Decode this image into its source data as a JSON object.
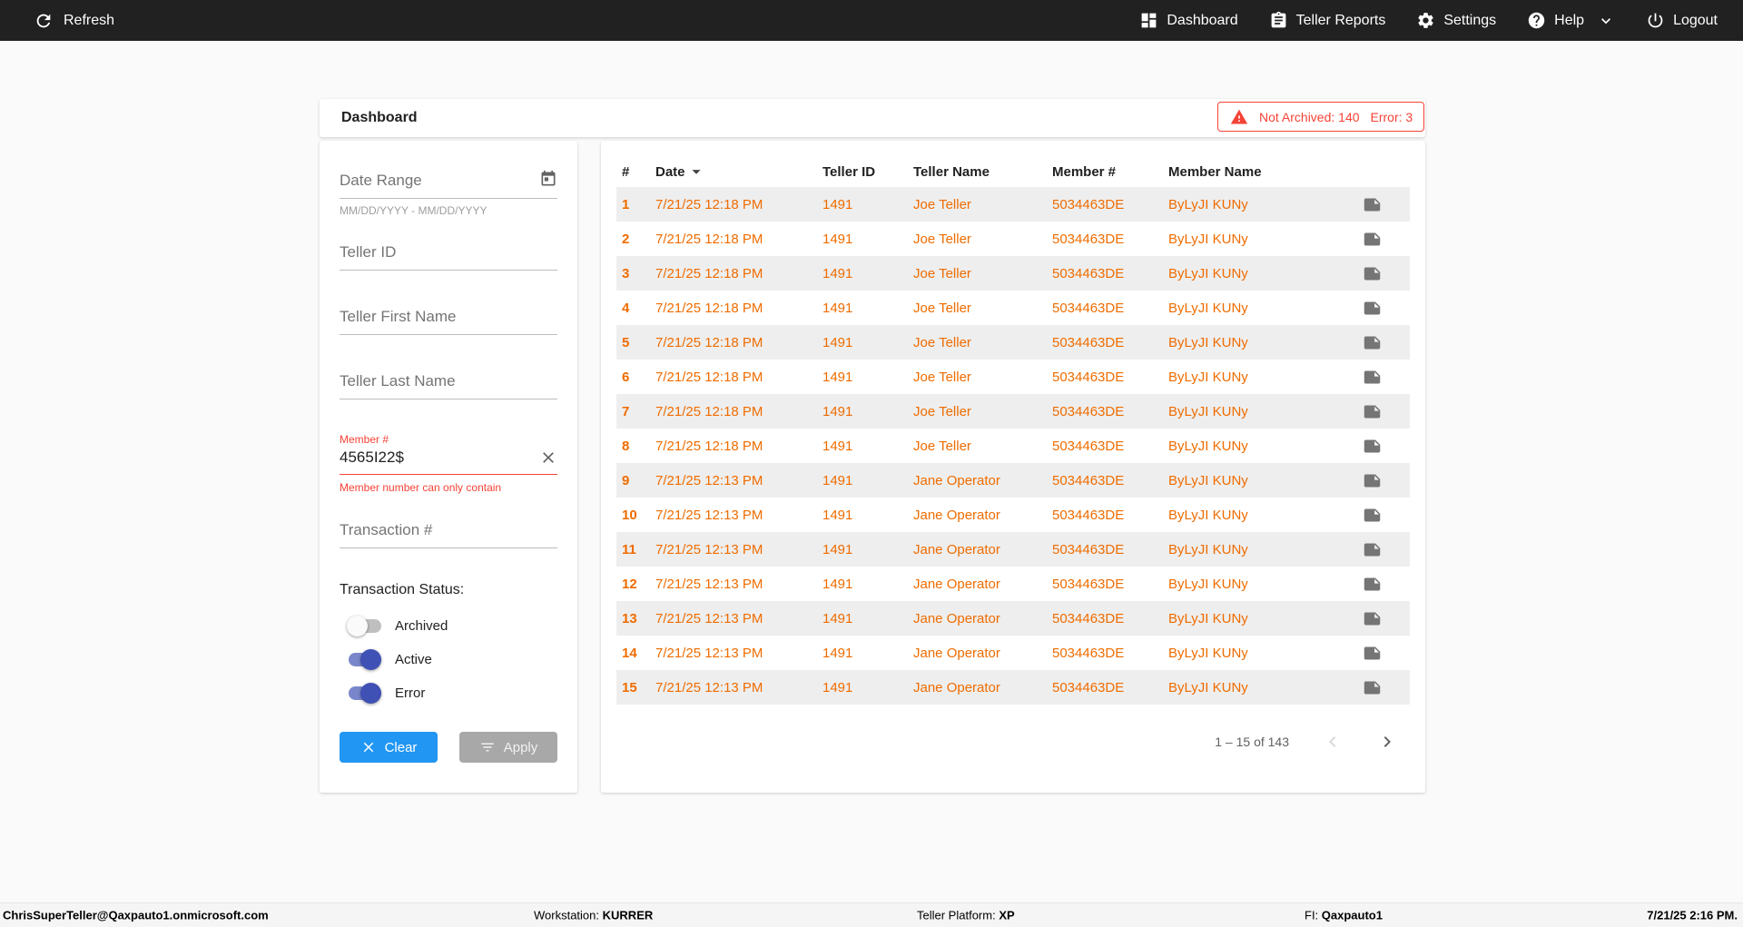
{
  "colors": {
    "topbar_bg": "#212121",
    "accent_orange": "#EF6C00",
    "error_red": "#F44336",
    "primary_blue": "#2196F3",
    "toggle_blue": "#3F51B5"
  },
  "topbar": {
    "refresh_label": "Refresh",
    "nav": [
      {
        "label": "Dashboard",
        "icon": "dashboard-icon"
      },
      {
        "label": "Teller Reports",
        "icon": "report-icon"
      },
      {
        "label": "Settings",
        "icon": "gear-icon"
      },
      {
        "label": "Help",
        "icon": "help-icon"
      },
      {
        "label": "Logout",
        "icon": "power-icon"
      }
    ]
  },
  "page": {
    "title": "Dashboard"
  },
  "alert": {
    "not_archived": "Not Archived: 140",
    "error": "Error: 3"
  },
  "filters": {
    "date_range": {
      "placeholder": "Date Range",
      "hint": "MM/DD/YYYY - MM/DD/YYYY"
    },
    "teller_id_placeholder": "Teller ID",
    "teller_first_name_placeholder": "Teller First Name",
    "teller_last_name_placeholder": "Teller Last Name",
    "member": {
      "label": "Member #",
      "value": "4565I22$",
      "error": "Member number can only contain"
    },
    "transaction_placeholder": "Transaction #",
    "status_label": "Transaction Status:",
    "toggles": [
      {
        "label": "Archived",
        "on": false
      },
      {
        "label": "Active",
        "on": true
      },
      {
        "label": "Error",
        "on": true
      }
    ],
    "clear_label": "Clear",
    "apply_label": "Apply"
  },
  "table": {
    "columns": [
      "#",
      "Date",
      "Teller ID",
      "Teller Name",
      "Member #",
      "Member Name"
    ],
    "rows": [
      {
        "num": "1",
        "date": "7/21/25 12:18 PM",
        "teller_id": "1491",
        "teller_name": "Joe Teller",
        "member_num": "5034463DE",
        "member_name": "ByLyJI KUNy"
      },
      {
        "num": "2",
        "date": "7/21/25 12:18 PM",
        "teller_id": "1491",
        "teller_name": "Joe Teller",
        "member_num": "5034463DE",
        "member_name": "ByLyJI KUNy"
      },
      {
        "num": "3",
        "date": "7/21/25 12:18 PM",
        "teller_id": "1491",
        "teller_name": "Joe Teller",
        "member_num": "5034463DE",
        "member_name": "ByLyJI KUNy"
      },
      {
        "num": "4",
        "date": "7/21/25 12:18 PM",
        "teller_id": "1491",
        "teller_name": "Joe Teller",
        "member_num": "5034463DE",
        "member_name": "ByLyJI KUNy"
      },
      {
        "num": "5",
        "date": "7/21/25 12:18 PM",
        "teller_id": "1491",
        "teller_name": "Joe Teller",
        "member_num": "5034463DE",
        "member_name": "ByLyJI KUNy"
      },
      {
        "num": "6",
        "date": "7/21/25 12:18 PM",
        "teller_id": "1491",
        "teller_name": "Joe Teller",
        "member_num": "5034463DE",
        "member_name": "ByLyJI KUNy"
      },
      {
        "num": "7",
        "date": "7/21/25 12:18 PM",
        "teller_id": "1491",
        "teller_name": "Joe Teller",
        "member_num": "5034463DE",
        "member_name": "ByLyJI KUNy"
      },
      {
        "num": "8",
        "date": "7/21/25 12:18 PM",
        "teller_id": "1491",
        "teller_name": "Joe Teller",
        "member_num": "5034463DE",
        "member_name": "ByLyJI KUNy"
      },
      {
        "num": "9",
        "date": "7/21/25 12:13 PM",
        "teller_id": "1491",
        "teller_name": "Jane Operator",
        "member_num": "5034463DE",
        "member_name": "ByLyJI KUNy"
      },
      {
        "num": "10",
        "date": "7/21/25 12:13 PM",
        "teller_id": "1491",
        "teller_name": "Jane Operator",
        "member_num": "5034463DE",
        "member_name": "ByLyJI KUNy"
      },
      {
        "num": "11",
        "date": "7/21/25 12:13 PM",
        "teller_id": "1491",
        "teller_name": "Jane Operator",
        "member_num": "5034463DE",
        "member_name": "ByLyJI KUNy"
      },
      {
        "num": "12",
        "date": "7/21/25 12:13 PM",
        "teller_id": "1491",
        "teller_name": "Jane Operator",
        "member_num": "5034463DE",
        "member_name": "ByLyJI KUNy"
      },
      {
        "num": "13",
        "date": "7/21/25 12:13 PM",
        "teller_id": "1491",
        "teller_name": "Jane Operator",
        "member_num": "5034463DE",
        "member_name": "ByLyJI KUNy"
      },
      {
        "num": "14",
        "date": "7/21/25 12:13 PM",
        "teller_id": "1491",
        "teller_name": "Jane Operator",
        "member_num": "5034463DE",
        "member_name": "ByLyJI KUNy"
      },
      {
        "num": "15",
        "date": "7/21/25 12:13 PM",
        "teller_id": "1491",
        "teller_name": "Jane Operator",
        "member_num": "5034463DE",
        "member_name": "ByLyJI KUNy"
      }
    ],
    "pagination": {
      "range_label": "1 – 15 of 143"
    }
  },
  "footer": {
    "user": "ChrisSuperTeller@Qaxpauto1.onmicrosoft.com",
    "workstation_label": "Workstation:",
    "workstation_value": "KURRER",
    "platform_label": "Teller Platform:",
    "platform_value": "XP",
    "fi_label": "FI:",
    "fi_value": "Qaxpauto1",
    "datetime": "7/21/25 2:16 PM."
  }
}
